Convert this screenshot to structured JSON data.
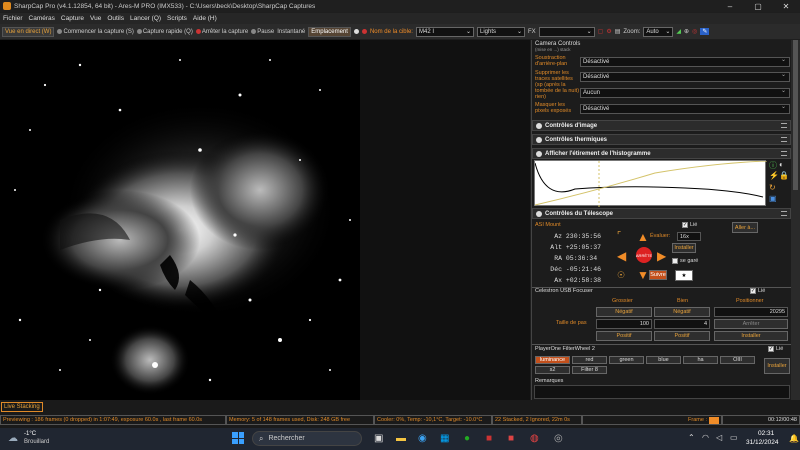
{
  "window": {
    "title": "SharpCap Pro (v4.1.12854, 64 bit) - Ares-M PRO (IMX533) - C:\\Users\\beck\\Desktop\\SharpCap Captures"
  },
  "menu": [
    "Fichier",
    "Caméras",
    "Capture",
    "Vue",
    "Outils",
    "Lancer (Q)",
    "Scripts",
    "Aide (H)"
  ],
  "toolbar": {
    "live": "Vue en direct (W)",
    "start_capture": "Commencer la capture (S)",
    "quick_capture": "Capture rapide (Q)",
    "stop_capture": "Arrêter la capture",
    "pause": "Pause",
    "snapshot": "Instantané",
    "placement": "Emplacement",
    "target_label": "Nom de la cible:",
    "target_value": "M42 I",
    "frame_type": "Lights",
    "fx_label": "FX",
    "zoom_label": "Zoom:",
    "zoom_value": "Auto"
  },
  "camera_controls": {
    "title": "Camera Controls",
    "subtitle": "(mise en ...) stack",
    "rows": [
      {
        "label": "Soustraction d'arrière-plan",
        "value": "Désactivé"
      },
      {
        "label": "Supprimer les traces satellites (sp (après la tombée de la nuit) rien)",
        "value": "Désactivé"
      },
      {
        "label": "",
        "value": "Aucun"
      },
      {
        "label": "Masquer les pixels exposés",
        "value": "Désactivé"
      }
    ]
  },
  "sections": {
    "image": "Contrôles d'image",
    "thermal": "Contrôles thermiques",
    "histogram": "Afficher l'étirement de l'histogramme",
    "telescope": "Contrôles du Télescope"
  },
  "telescope": {
    "mount": "ASI Mount",
    "lie": "Lié",
    "evaluate": "Évaluer:",
    "rate": "16x",
    "goto": "Aller à...",
    "install": "Installer",
    "stop": "ARRÊTE",
    "parked": "se garé",
    "follow": "Suivre",
    "coords": [
      {
        "k": "Az",
        "v": "230:35:56"
      },
      {
        "k": "Alt",
        "v": "+25:05:37"
      },
      {
        "k": "RA",
        "v": "05:36:34"
      },
      {
        "k": "Déc",
        "v": "-05:21:46"
      },
      {
        "k": "Ax",
        "v": "+02:58:38"
      }
    ]
  },
  "focuser": {
    "name": "Celestron USB Focuser",
    "lie": "Lié",
    "coarse": "Grossier",
    "fine": "Bien",
    "position": "Positionner",
    "negative": "Négatif",
    "step_label": "Taille de pas",
    "coarse_step": "100",
    "fine_step": "4",
    "position_value": "20295",
    "stop": "Arrêter",
    "positive": "Positif",
    "install": "Installer"
  },
  "filterwheel": {
    "name": "PlayerOne FilterWheel 2",
    "lie": "Lié",
    "filters": [
      "luminance",
      "red",
      "green",
      "blue",
      "ha",
      "OIII",
      "s2",
      "Filter 8"
    ],
    "active": "luminance",
    "install": "Installer"
  },
  "remarks": "Remarques",
  "status": {
    "live_stacking": "Live Stacking",
    "previewing": "Previewing : 186 frames (0 dropped) in 1:07:49, exposure 60.0s , last frame 60.0s",
    "memory": "Memory: 5 of 148 frames used, Disk: 248 GB free",
    "cooler": "Cooler: 0%, Temp: -10,1°C, Target: -10.0°C",
    "stacked": "22 Stacked, 2 Ignored, 22m 0s",
    "frame_label": "Frame :",
    "time": "00:12/00:48"
  },
  "taskbar": {
    "temp": "-1°C",
    "weather": "Brouillard",
    "search": "Rechercher",
    "clock": "02:31",
    "date": "31/12/2024"
  },
  "colors": {
    "accent": "#e08a28",
    "panel": "#1c1c1c"
  }
}
